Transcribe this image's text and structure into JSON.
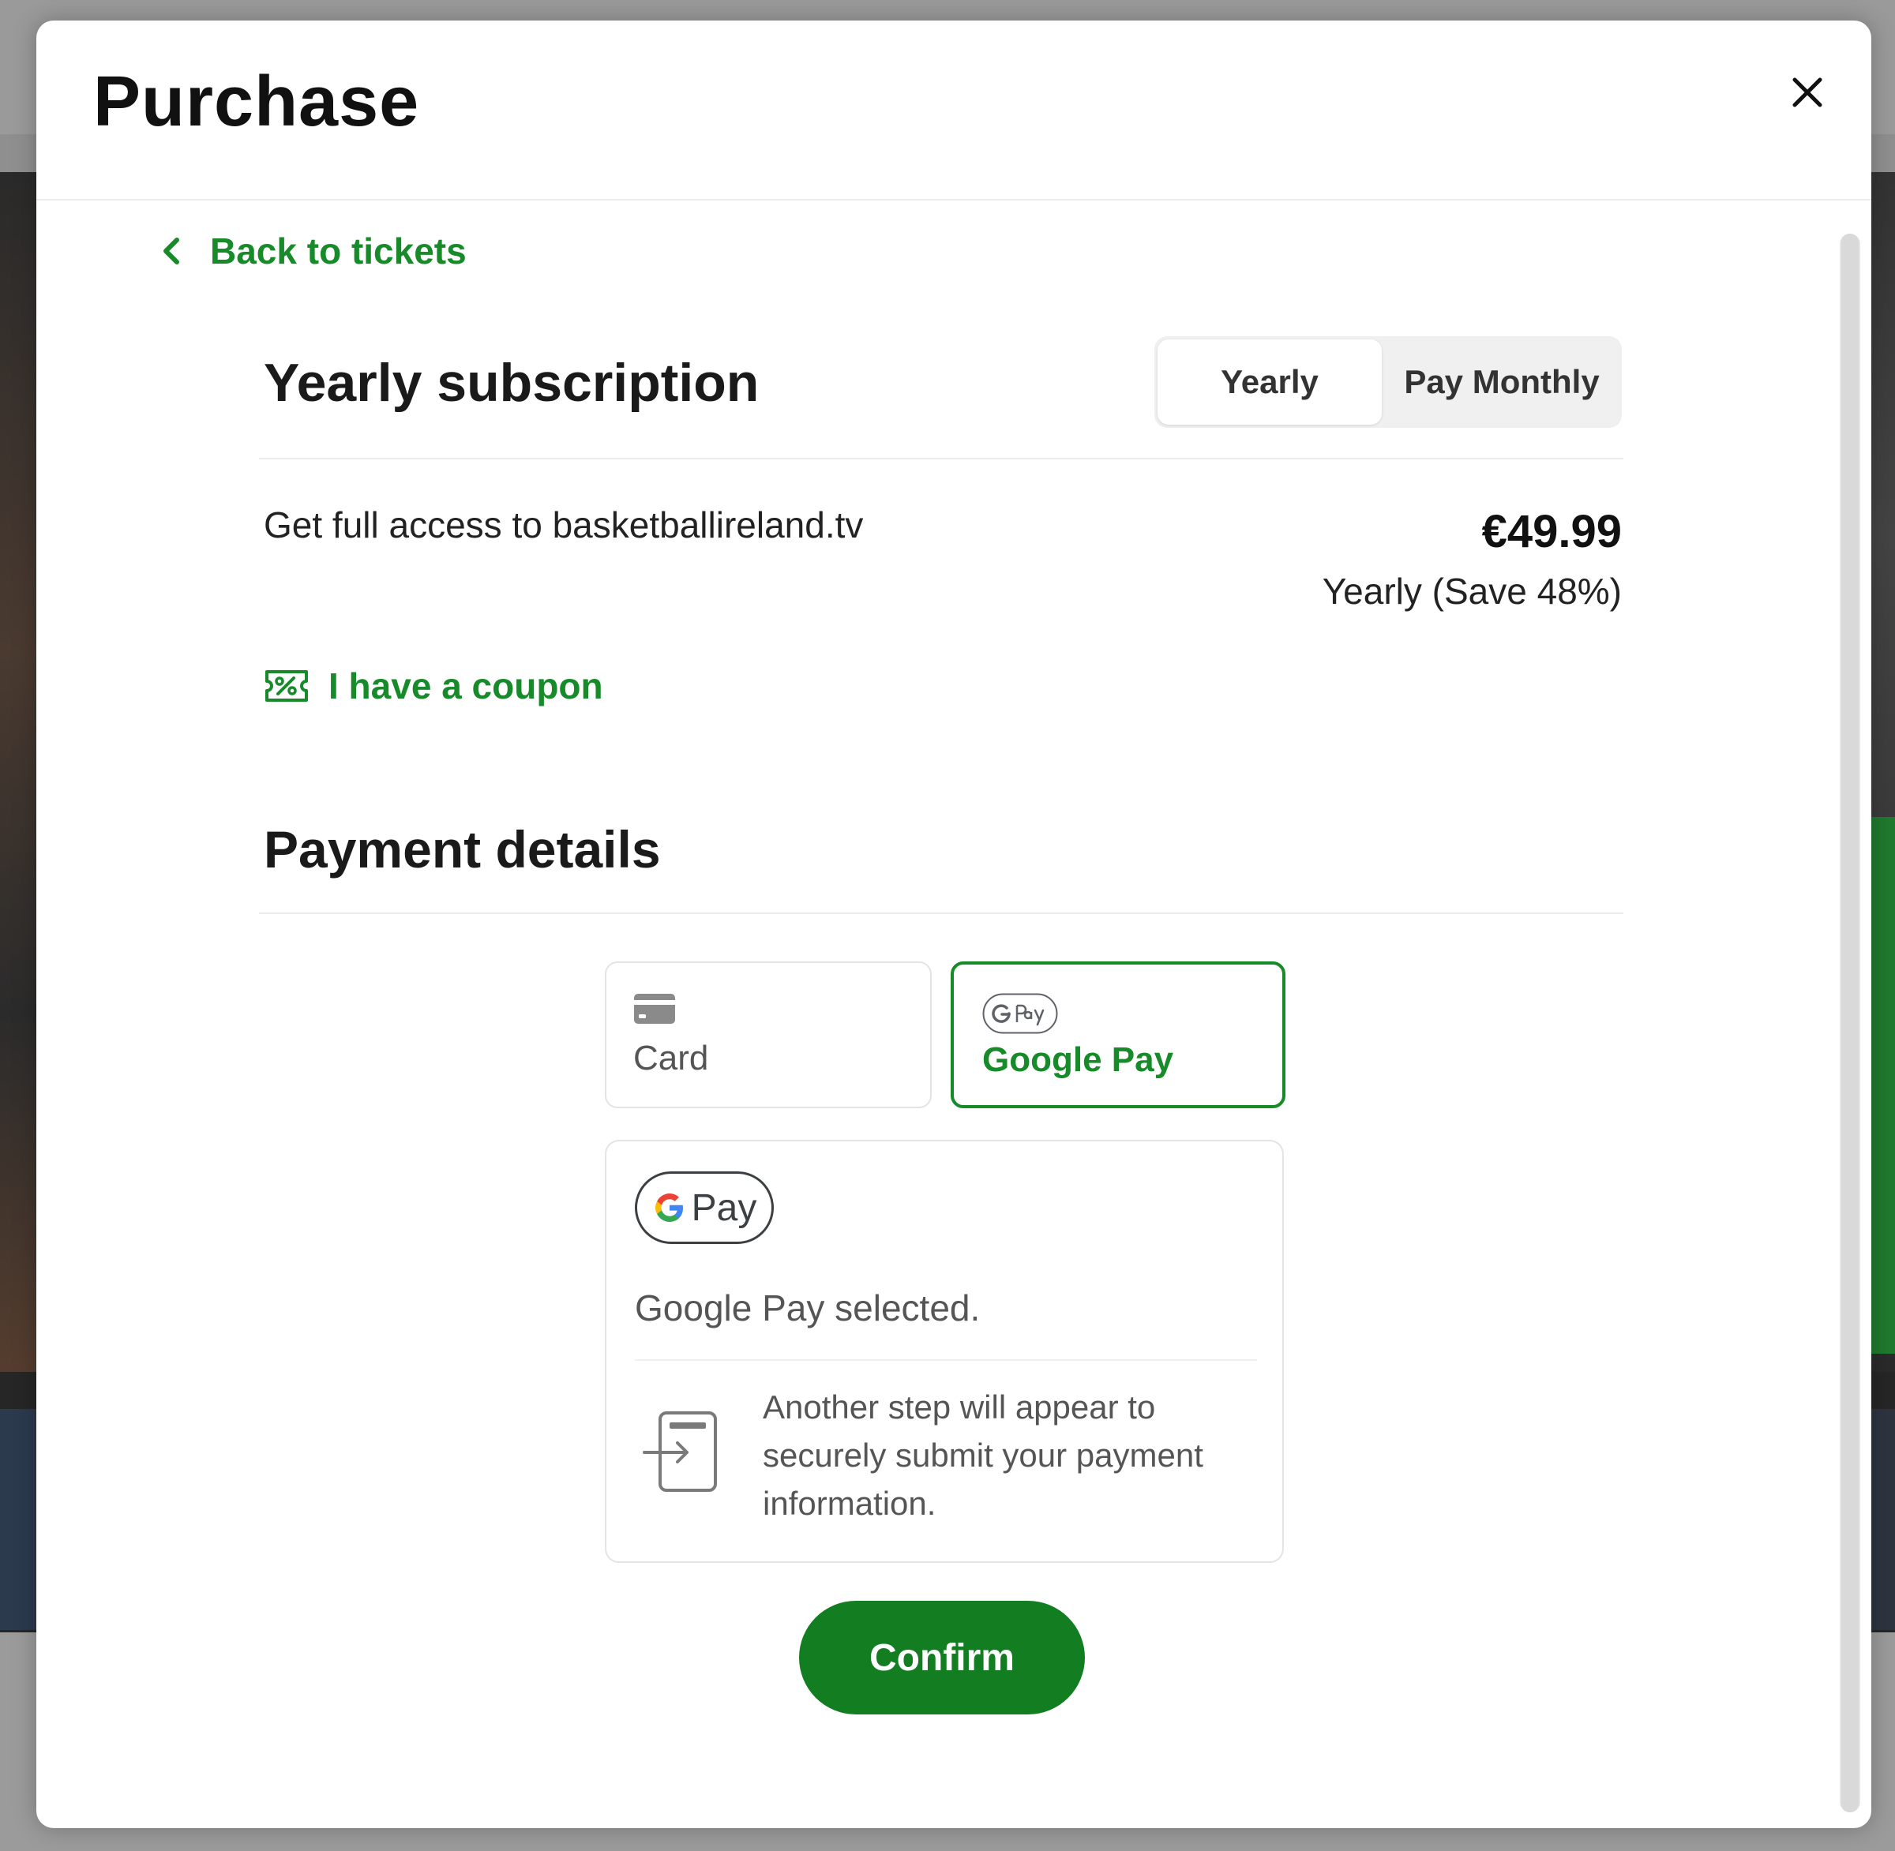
{
  "modal": {
    "title": "Purchase",
    "close_icon": "close-icon"
  },
  "nav": {
    "back_label": "Back to tickets",
    "back_icon": "chevron-left-icon"
  },
  "subscription": {
    "title": "Yearly subscription",
    "toggle": {
      "options": [
        "Yearly",
        "Pay Monthly"
      ],
      "selected": "Yearly"
    },
    "description": "Get full access to basketballireland.tv",
    "price": "€49.99",
    "price_note": "Yearly (Save 48%)",
    "coupon_label": "I have a coupon",
    "coupon_icon": "coupon-percent-icon"
  },
  "payment": {
    "title": "Payment details",
    "methods": [
      {
        "label": "Card",
        "icon": "credit-card-icon",
        "selected": false
      },
      {
        "label": "Google Pay",
        "icon": "google-pay-icon",
        "selected": true
      }
    ],
    "gpay_badge_text": "Pay",
    "selected_text": "Google Pay selected.",
    "step_text": "Another step will appear to securely submit your payment information.",
    "step_icon": "redirect-step-icon"
  },
  "actions": {
    "confirm_label": "Confirm"
  },
  "colors": {
    "accent": "#178a2a",
    "confirm_bg": "#137d22",
    "text": "#1a1a1a"
  }
}
